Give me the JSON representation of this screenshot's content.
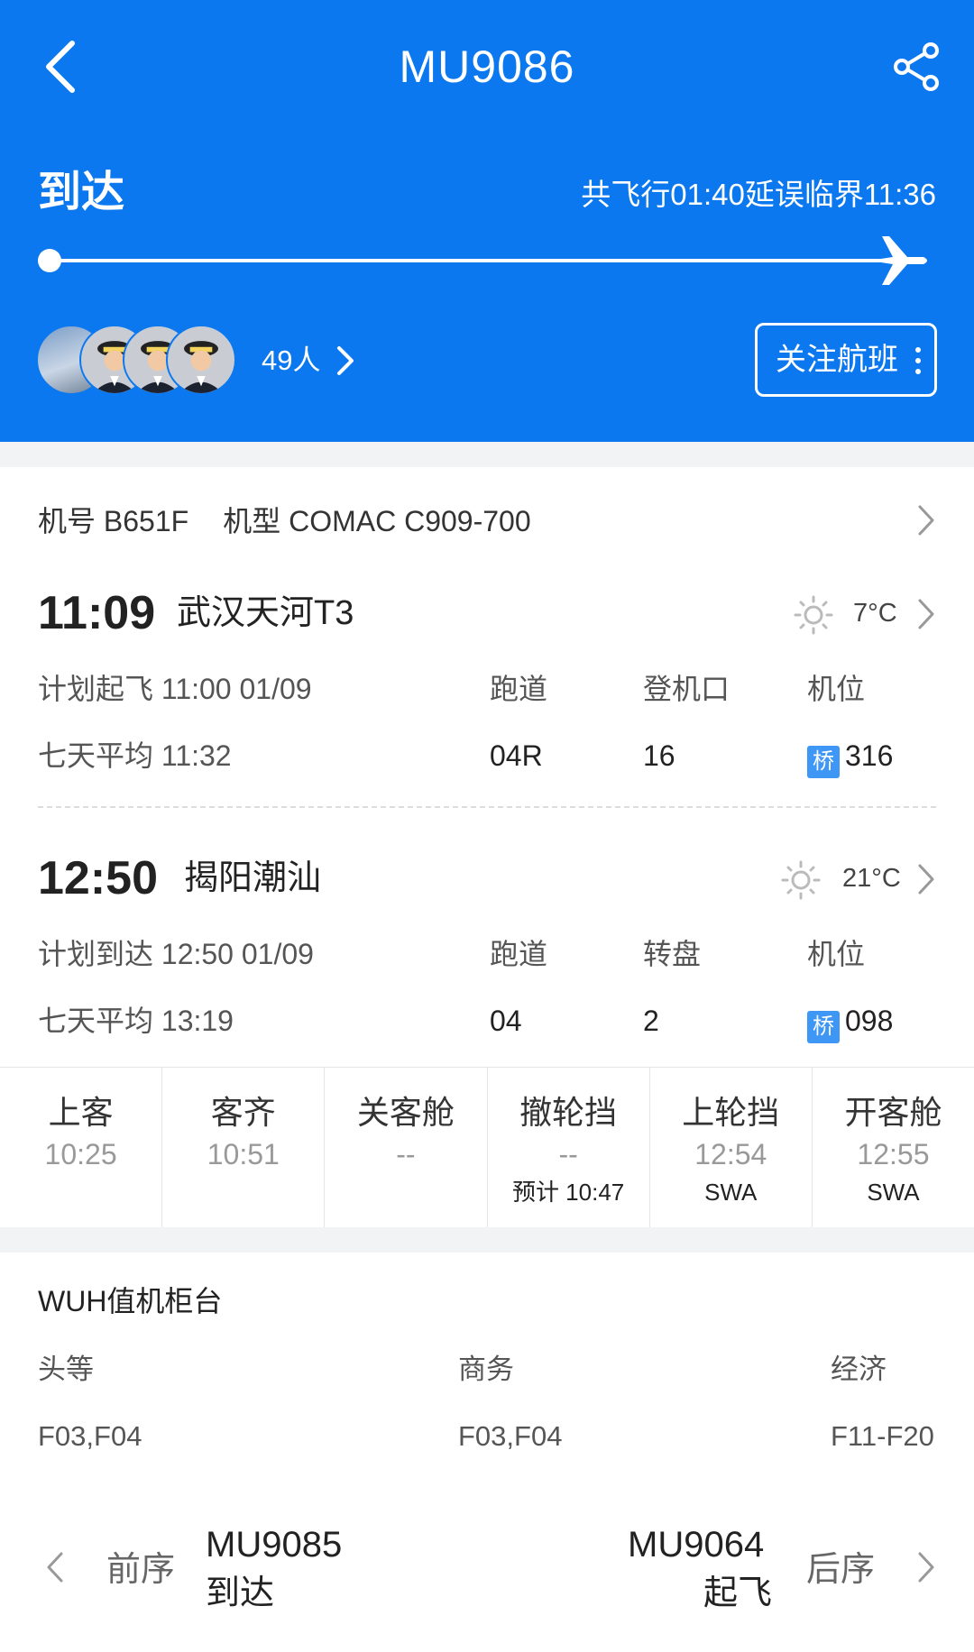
{
  "header": {
    "title": "MU9086",
    "status": "到达",
    "flight_summary": "共飞行01:40延误临界11:36",
    "progress": 1.0,
    "crew_count": "49人",
    "follow_label": "关注航班"
  },
  "aircraft": {
    "reg_label": "机号 B651F",
    "type_label": "机型 COMAC C909-700"
  },
  "departure": {
    "time": "11:09",
    "airport": "武汉天河T3",
    "temp": "7°C",
    "planned_label": "计划起飞 11:00 01/09",
    "avg_label": "七天平均 11:32",
    "col1_label": "跑道",
    "col1_value": "04R",
    "col2_label": "登机口",
    "col2_value": "16",
    "col3_label": "机位",
    "col3_badge": "桥",
    "col3_value": "316"
  },
  "arrival": {
    "time": "12:50",
    "airport": "揭阳潮汕",
    "temp": "21°C",
    "planned_label": "计划到达 12:50 01/09",
    "avg_label": "七天平均 13:19",
    "col1_label": "跑道",
    "col1_value": "04",
    "col2_label": "转盘",
    "col2_value": "2",
    "col3_label": "机位",
    "col3_badge": "桥",
    "col3_value": "098"
  },
  "events": [
    {
      "name": "上客",
      "time": "10:25",
      "note": ""
    },
    {
      "name": "客齐",
      "time": "10:51",
      "note": ""
    },
    {
      "name": "关客舱",
      "time": "--",
      "note": ""
    },
    {
      "name": "撤轮挡",
      "time": "--",
      "note": "预计 10:47"
    },
    {
      "name": "上轮挡",
      "time": "12:54",
      "note": "SWA"
    },
    {
      "name": "开客舱",
      "time": "12:55",
      "note": "SWA"
    }
  ],
  "checkin": {
    "title": "WUH值机柜台",
    "first_label": "头等",
    "first_value": "F03,F04",
    "business_label": "商务",
    "business_value": "F03,F04",
    "economy_label": "经济",
    "economy_value": "F11-F20"
  },
  "sequence": {
    "prev_label": "前序",
    "prev_flight": "MU9085",
    "prev_status": "到达",
    "next_label": "后序",
    "next_flight": "MU9064",
    "next_status": "起飞"
  },
  "colors": {
    "brand": "#0b78f0",
    "badge": "#3e97f5"
  }
}
